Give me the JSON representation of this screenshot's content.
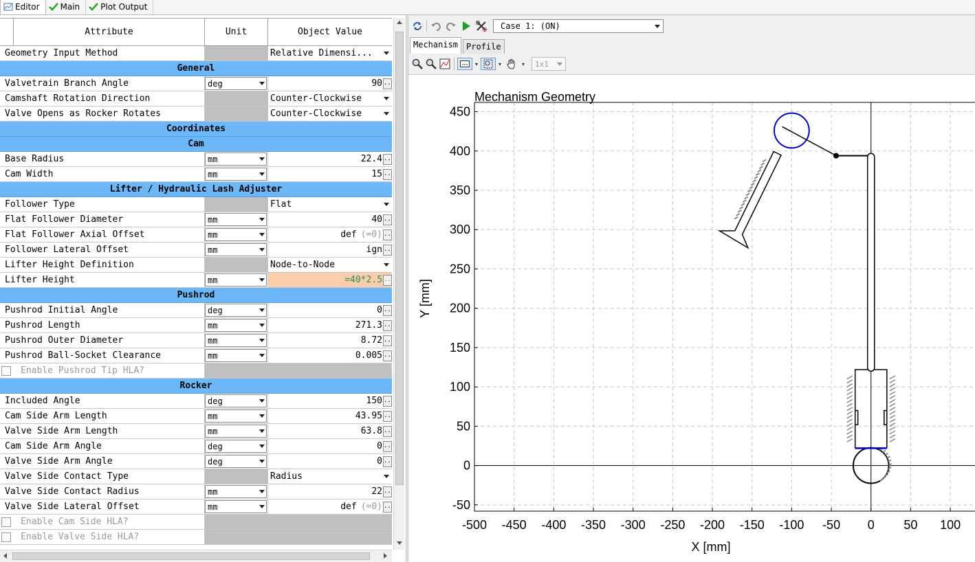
{
  "tabs": [
    {
      "label": "Editor",
      "active": true
    },
    {
      "label": "Main",
      "active": false
    },
    {
      "label": "Plot Output",
      "active": false
    }
  ],
  "editor": {
    "columns": [
      "Attribute",
      "Unit",
      "Object Value"
    ],
    "rows": [
      {
        "type": "row",
        "name": "Geometry Input Method",
        "unit": "",
        "value": "Relative Dimensi...",
        "kind": "select"
      },
      {
        "type": "section",
        "name": "General"
      },
      {
        "type": "row",
        "name": "Valvetrain Branch Angle",
        "unit": "deg",
        "value": "90",
        "kind": "num"
      },
      {
        "type": "row",
        "name": "Camshaft Rotation Direction",
        "unit": "",
        "value": "Counter-Clockwise",
        "kind": "select"
      },
      {
        "type": "row",
        "name": "Valve Opens as Rocker Rotates",
        "unit": "",
        "value": "Counter-Clockwise",
        "kind": "select"
      },
      {
        "type": "section",
        "name": "Coordinates"
      },
      {
        "type": "section",
        "name": "Cam"
      },
      {
        "type": "row",
        "name": "Base Radius",
        "unit": "mm",
        "value": "22.4",
        "kind": "num"
      },
      {
        "type": "row",
        "name": "Cam Width",
        "unit": "mm",
        "value": "15",
        "kind": "num"
      },
      {
        "type": "section",
        "name": "Lifter / Hydraulic Lash Adjuster"
      },
      {
        "type": "row",
        "name": "Follower Type",
        "unit": "",
        "value": "Flat",
        "kind": "select"
      },
      {
        "type": "row",
        "name": "Flat Follower Diameter",
        "unit": "mm",
        "value": "40",
        "kind": "num"
      },
      {
        "type": "row",
        "name": "Flat Follower Axial Offset",
        "unit": "mm",
        "value": "def",
        "value_note": "(=0)",
        "kind": "num"
      },
      {
        "type": "row",
        "name": "Follower Lateral Offset",
        "unit": "mm",
        "value": "ign",
        "kind": "num"
      },
      {
        "type": "row",
        "name": "Lifter Height Definition",
        "unit": "",
        "value": "Node-to-Node",
        "kind": "select"
      },
      {
        "type": "row",
        "name": "Lifter Height",
        "unit": "mm",
        "value": "=40*2.5",
        "kind": "formula"
      },
      {
        "type": "section",
        "name": "Pushrod"
      },
      {
        "type": "row",
        "name": "Pushrod Initial Angle",
        "unit": "deg",
        "value": "0",
        "kind": "num"
      },
      {
        "type": "row",
        "name": "Pushrod Length",
        "unit": "mm",
        "value": "271.3",
        "kind": "num"
      },
      {
        "type": "row",
        "name": "Pushrod Outer Diameter",
        "unit": "mm",
        "value": "8.72",
        "kind": "num"
      },
      {
        "type": "row",
        "name": "Pushrod Ball-Socket Clearance",
        "unit": "mm",
        "value": "0.005",
        "kind": "num"
      },
      {
        "type": "check",
        "name": "Enable Pushrod Tip HLA?"
      },
      {
        "type": "section",
        "name": "Rocker"
      },
      {
        "type": "row",
        "name": "Included Angle",
        "unit": "deg",
        "value": "150",
        "kind": "num"
      },
      {
        "type": "row",
        "name": "Cam Side Arm Length",
        "unit": "mm",
        "value": "43.95",
        "kind": "num"
      },
      {
        "type": "row",
        "name": "Valve Side Arm Length",
        "unit": "mm",
        "value": "63.8",
        "kind": "num"
      },
      {
        "type": "row",
        "name": "Cam Side Arm Angle",
        "unit": "deg",
        "value": "0",
        "kind": "num"
      },
      {
        "type": "row",
        "name": "Valve Side Arm Angle",
        "unit": "deg",
        "value": "0",
        "kind": "num"
      },
      {
        "type": "row",
        "name": "Valve Side Contact Type",
        "unit": "",
        "value": "Radius",
        "kind": "select"
      },
      {
        "type": "row",
        "name": "Valve Side Contact Radius",
        "unit": "mm",
        "value": "22",
        "kind": "num"
      },
      {
        "type": "row",
        "name": "Valve Side Lateral Offset",
        "unit": "mm",
        "value": "def",
        "value_note": "(=0)",
        "kind": "num"
      },
      {
        "type": "check",
        "name": "Enable Cam Side HLA?"
      },
      {
        "type": "check",
        "name": "Enable Valve Side HLA?"
      }
    ]
  },
  "right_panel": {
    "case_select": "Case 1:  (ON)",
    "subtabs": [
      {
        "label": "Mechanism",
        "active": true
      },
      {
        "label": "Profile",
        "active": false
      }
    ],
    "layout_select": "1x1"
  },
  "chart_data": {
    "type": "scatter",
    "title": "Mechanism Geometry",
    "xlabel": "X [mm]",
    "ylabel": "Y [mm]",
    "xlim": [
      -500,
      135
    ],
    "ylim": [
      -58,
      460
    ],
    "xticks": [
      -500,
      -450,
      -400,
      -350,
      -300,
      -250,
      -200,
      -150,
      -100,
      -50,
      0,
      50,
      100
    ],
    "yticks": [
      -50,
      0,
      50,
      100,
      150,
      200,
      250,
      300,
      350,
      400,
      450
    ],
    "grid": true,
    "elements": {
      "cam_center": [
        0,
        0
      ],
      "cam_base_radius": 22.4,
      "lifter_top_y": 122,
      "lifter_bottom_y": 22,
      "pushrod_top": [
        0,
        394
      ],
      "rocker_pivot": [
        -100,
        426
      ],
      "rocker_cam_arm_end": [
        -44,
        394
      ],
      "valve_tip": [
        -118,
        397
      ],
      "valve_head": [
        -170,
        290
      ]
    },
    "colors": {
      "contact": "#0000cc",
      "geometry": "#000000",
      "hatch": "#888888"
    }
  }
}
